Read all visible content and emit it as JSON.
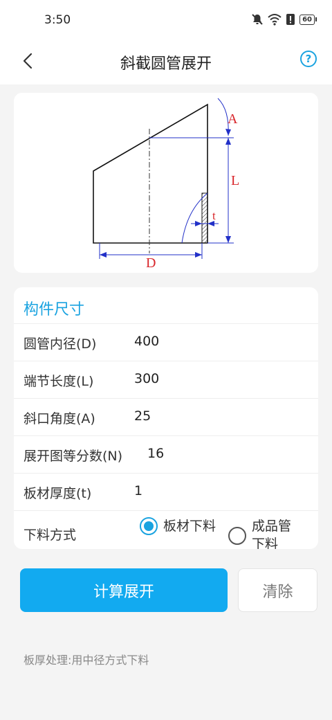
{
  "status": {
    "time": "3:50",
    "battery": "60"
  },
  "appbar": {
    "title": "斜截圆管展开",
    "help": "?"
  },
  "diagram": {
    "label_a": "A",
    "label_l": "L",
    "label_t": "t",
    "label_d": "D"
  },
  "form": {
    "section_title": "构件尺寸",
    "rows": [
      {
        "label": "圆管内径(D)",
        "value": "400"
      },
      {
        "label": "端节长度(L)",
        "value": "300"
      },
      {
        "label": "斜口角度(A)",
        "value": "25"
      },
      {
        "label": "展开图等分数(N)",
        "value": "16"
      },
      {
        "label": "板材厚度(t)",
        "value": "1"
      }
    ],
    "cut_method": {
      "label": "下料方式",
      "options": [
        {
          "label": "板材下料",
          "selected": true
        },
        {
          "label_line1": "成品管",
          "label_line2": "下料",
          "selected": false
        }
      ]
    }
  },
  "actions": {
    "calculate": "计算展开",
    "clear": "清除"
  },
  "note": "板厚处理:用中径方式下料",
  "colors": {
    "accent": "#1aa3e0",
    "button": "#12aaf0",
    "dim_blue": "#2230c8",
    "dim_red": "#d8262b"
  }
}
